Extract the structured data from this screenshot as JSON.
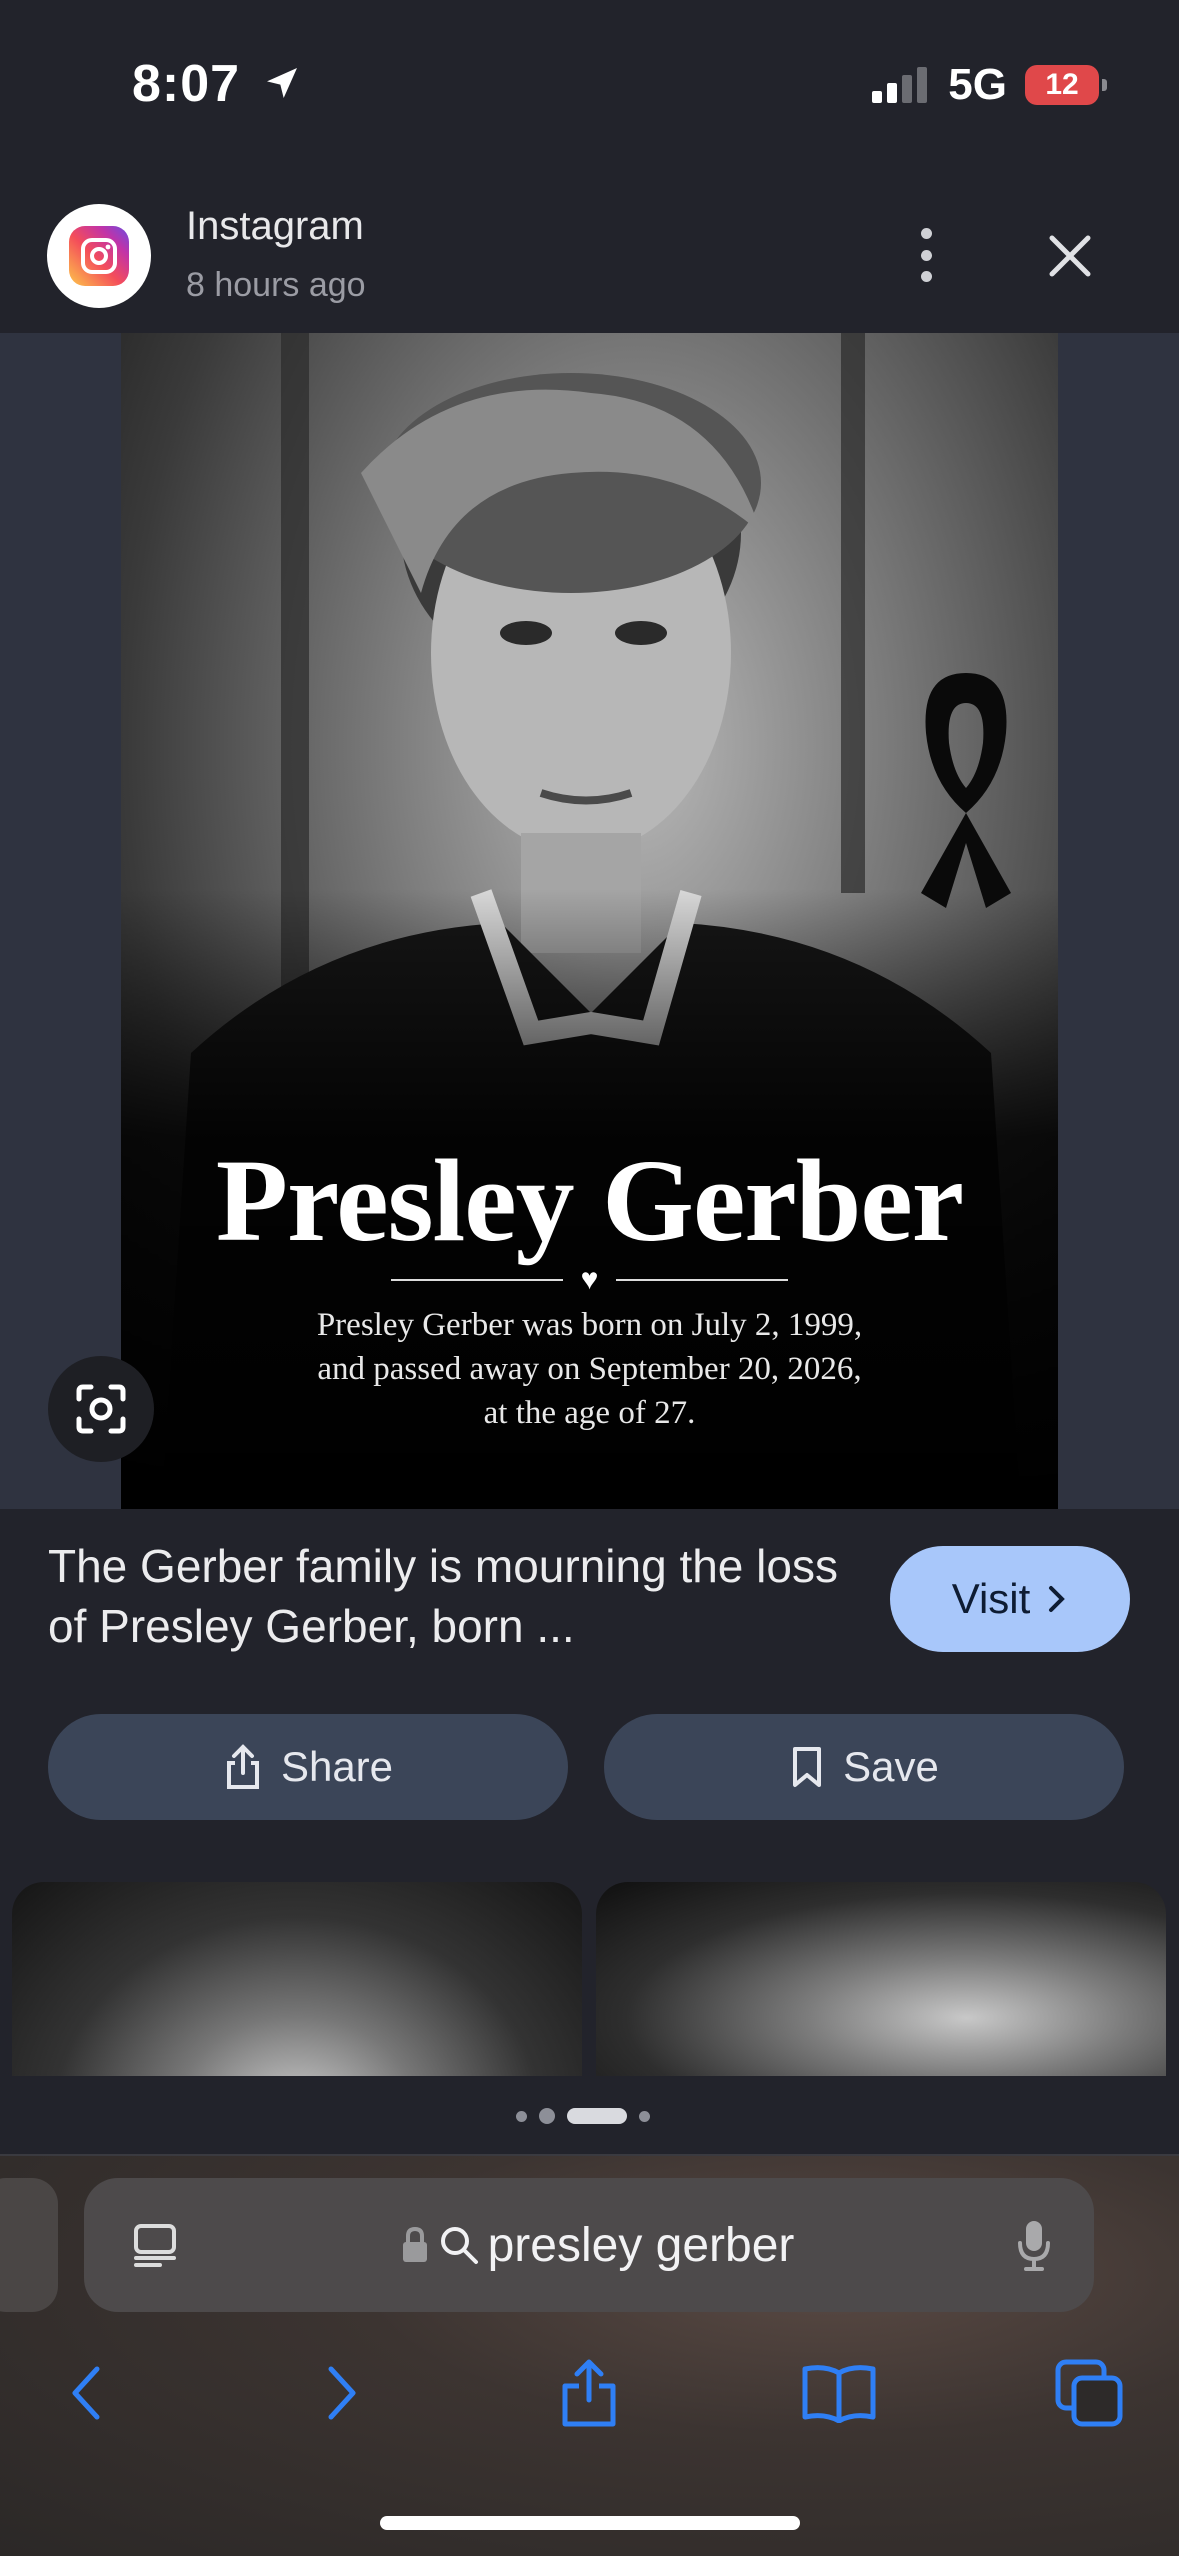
{
  "status_bar": {
    "time": "8:07",
    "network": "5G",
    "battery": "12"
  },
  "header": {
    "source_name": "Instagram",
    "source_time": "8 hours ago"
  },
  "image": {
    "name": "Presley Gerber",
    "line1": "Presley Gerber was born on July 2, 1999,",
    "line2": "and passed away on September 20, 2026,",
    "line3": "at the age of 27."
  },
  "result": {
    "caption": "The Gerber family is mourning the loss of Presley Gerber, born ...",
    "visit_label": "Visit"
  },
  "actions": {
    "share_label": "Share",
    "save_label": "Save"
  },
  "browser": {
    "search_query": "presley gerber"
  },
  "colors": {
    "visit_button": "#a8c7fa",
    "action_pill": "#3b4558",
    "battery_low": "#e0484a",
    "toolbar_icons": "#2f7ff5"
  },
  "icons": [
    "location-arrow-icon",
    "signal-icon",
    "battery-icon",
    "instagram-icon",
    "more-icon",
    "close-icon",
    "lens-icon",
    "chevron-right-icon",
    "share-icon",
    "bookmark-icon",
    "tabs-overview-icon",
    "lock-icon",
    "search-icon",
    "microphone-icon",
    "back-icon",
    "forward-icon",
    "share-toolbar-icon",
    "bookmarks-icon",
    "tabs-icon"
  ]
}
